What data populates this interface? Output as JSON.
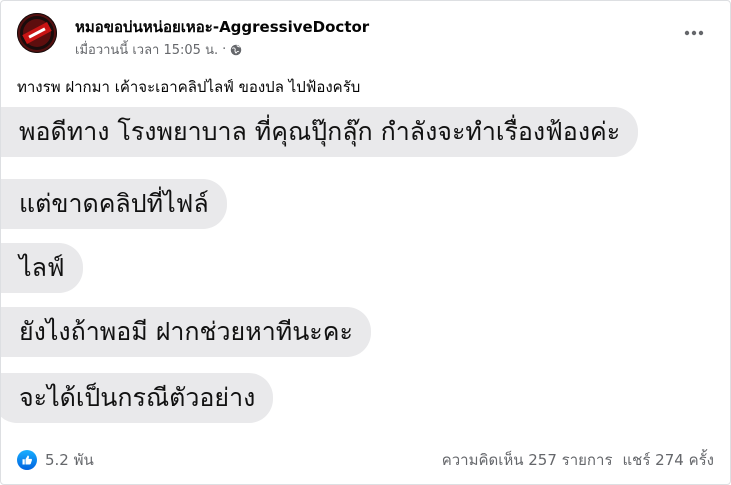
{
  "post": {
    "page_name": "หมอขอบ่นหน่อยเหอะ-AggressiveDoctor",
    "timestamp": "เมื่อวานนี้ เวลา 15:05 น.",
    "separator": "·",
    "privacy_icon": "globe-icon",
    "more_icon": "more-options-icon",
    "caption": "ทางรพ ฝากมา เค้าจะเอาคลิปไลฟ์ ของปล ไปฟ้องครับ"
  },
  "chat": {
    "bubbles": [
      "พอดีทาง โรงพยาบาล ที่คุณปุ๊กลุ๊ก กำลังจะทำเรื่องฟ้องค่ะ",
      "แต่ขาดคลิปที่ไฟล์",
      "ไลฟ์",
      "ยังไงถ้าพอมี ฝากช่วยหาทีนะคะ",
      "จะได้เป็นกรณีตัวอย่าง"
    ]
  },
  "footer": {
    "reaction_icon": "like-icon",
    "reaction_count": "5.2 พัน",
    "comments": "ความคิดเห็น 257 รายการ",
    "shares": "แชร์ 274 ครั้ง"
  },
  "colors": {
    "bubble_bg": "#e9e9eb",
    "secondary_text": "#65676b",
    "like_blue": "#1877f2"
  }
}
